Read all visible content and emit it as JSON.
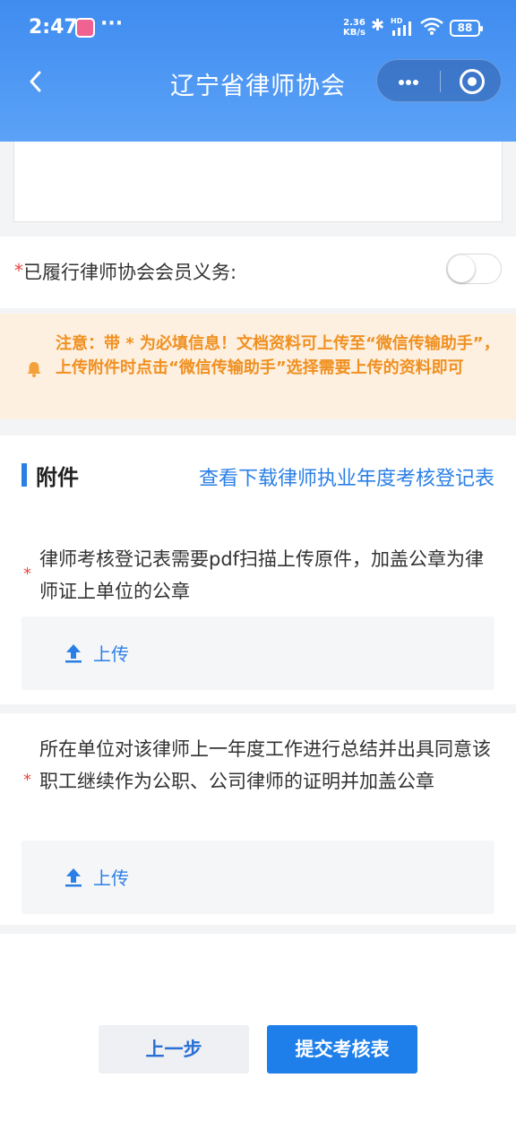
{
  "status_bar": {
    "time": "2:47",
    "more": "···",
    "net_speed_value": "2.36",
    "net_speed_unit": "KB/s",
    "network": "HD",
    "battery": "88"
  },
  "nav": {
    "title": "辽宁省律师协会"
  },
  "toggle": {
    "required_mark": "*",
    "label": "已履行律师协会会员义务:",
    "checked": false
  },
  "notice": {
    "text": "注意：带 * 为必填信息！文档资料可上传至“微信传输助手”，上传附件时点击“微信传输助手”选择需要上传的资料即可"
  },
  "attachments": {
    "title": "附件",
    "link": "查看下载律师执业年度考核登记表",
    "items": [
      {
        "required_mark": "*",
        "text": "律师考核登记表需要pdf扫描上传原件，加盖公章为律师证上单位的公章",
        "upload_label": "上传"
      },
      {
        "required_mark": "*",
        "text": "所在单位对该律师上一年度工作进行总结并出具同意该职工继续作为公职、公司律师的证明并加盖公章",
        "upload_label": "上传"
      }
    ]
  },
  "footer": {
    "prev_label": "上一步",
    "submit_label": "提交考核表"
  },
  "colors": {
    "header": "#4a95f4",
    "accent": "#1e7fea",
    "notice_bg": "#fdf0e1",
    "notice_text": "#f09020",
    "required": "#e8473f"
  }
}
